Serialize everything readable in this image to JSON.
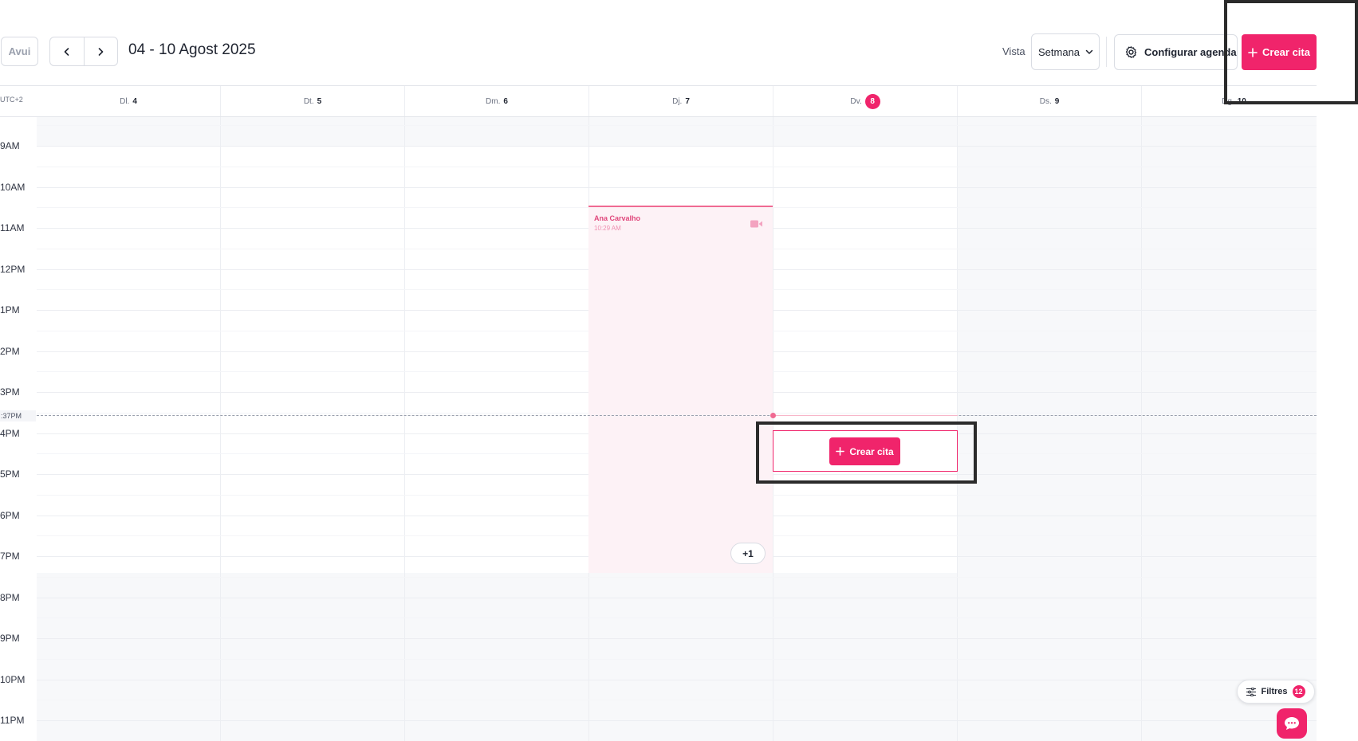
{
  "header": {
    "today_label": "Avui",
    "date_range": "04 - 10 Agost 2025",
    "view_label": "Vista",
    "view_value": "Setmana",
    "config_label": "Configurar agenda",
    "create_label": "Crear cita"
  },
  "calendar": {
    "timezone": "UTC+2",
    "days": [
      {
        "abbr": "Dl.",
        "num": "4"
      },
      {
        "abbr": "Dt.",
        "num": "5"
      },
      {
        "abbr": "Dm.",
        "num": "6"
      },
      {
        "abbr": "Dj.",
        "num": "7"
      },
      {
        "abbr": "Dv.",
        "num": "8",
        "today": true
      },
      {
        "abbr": "Ds.",
        "num": "9"
      },
      {
        "abbr": "Dg.",
        "num": "10"
      }
    ],
    "hours": [
      "9AM",
      "10AM",
      "11AM",
      "12PM",
      "1PM",
      "2PM",
      "3PM",
      "4PM",
      "5PM",
      "6PM",
      "7PM",
      "8PM",
      "9PM",
      "10PM",
      "11PM"
    ],
    "now_label": ":37PM",
    "event": {
      "name": "Ana Carvalho",
      "time": "10:29 AM",
      "icon": "video-camera-icon"
    },
    "more_label": "+1",
    "slot_create_label": "Crear cita"
  },
  "footer": {
    "filters_label": "Filtres",
    "filters_count": "12",
    "chat_icon": "chat-bubble-icon"
  },
  "colors": {
    "accent": "#f0246b",
    "event_bg": "#fdf2f6",
    "weekend_bg": "#f7f8fa"
  }
}
